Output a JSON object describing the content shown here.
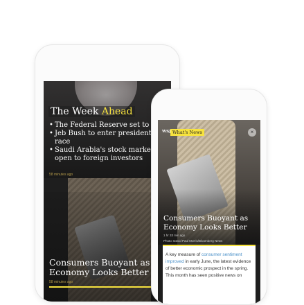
{
  "back_screen": {
    "briefing_title": "The Week",
    "briefing_title_accent": "Ahead",
    "briefing_items": [
      "The Federal Reserve set to mo",
      "Jeb Bush to enter presidentia race",
      "Saudi Arabia's stock market w open to foreign investors"
    ],
    "briefing_timestamp": "58 minutes ago",
    "headline": "Consumers Buoyant as Economy Looks Better",
    "headline_timestamp": "58 minutes ago"
  },
  "front_screen": {
    "logo": "WSJ",
    "section_tag": "What's News",
    "close_symbol": "×",
    "headline": "Consumers Buoyant as Economy Looks Better",
    "timestamp": "1 hr 33 min ago",
    "photo_credit": "Photo: David Paul Morris/Bloomberg News",
    "body_before_link": "A key measure of ",
    "body_link": "consumer sentiment improved",
    "body_after_link": " in early June, the latest evidence of better economic prospect in the spring. This month has seen positive news on"
  },
  "colors": {
    "accent_yellow": "#f7e33f",
    "link_blue": "#4a90c8",
    "phone_frame": "#fbfbfb"
  }
}
